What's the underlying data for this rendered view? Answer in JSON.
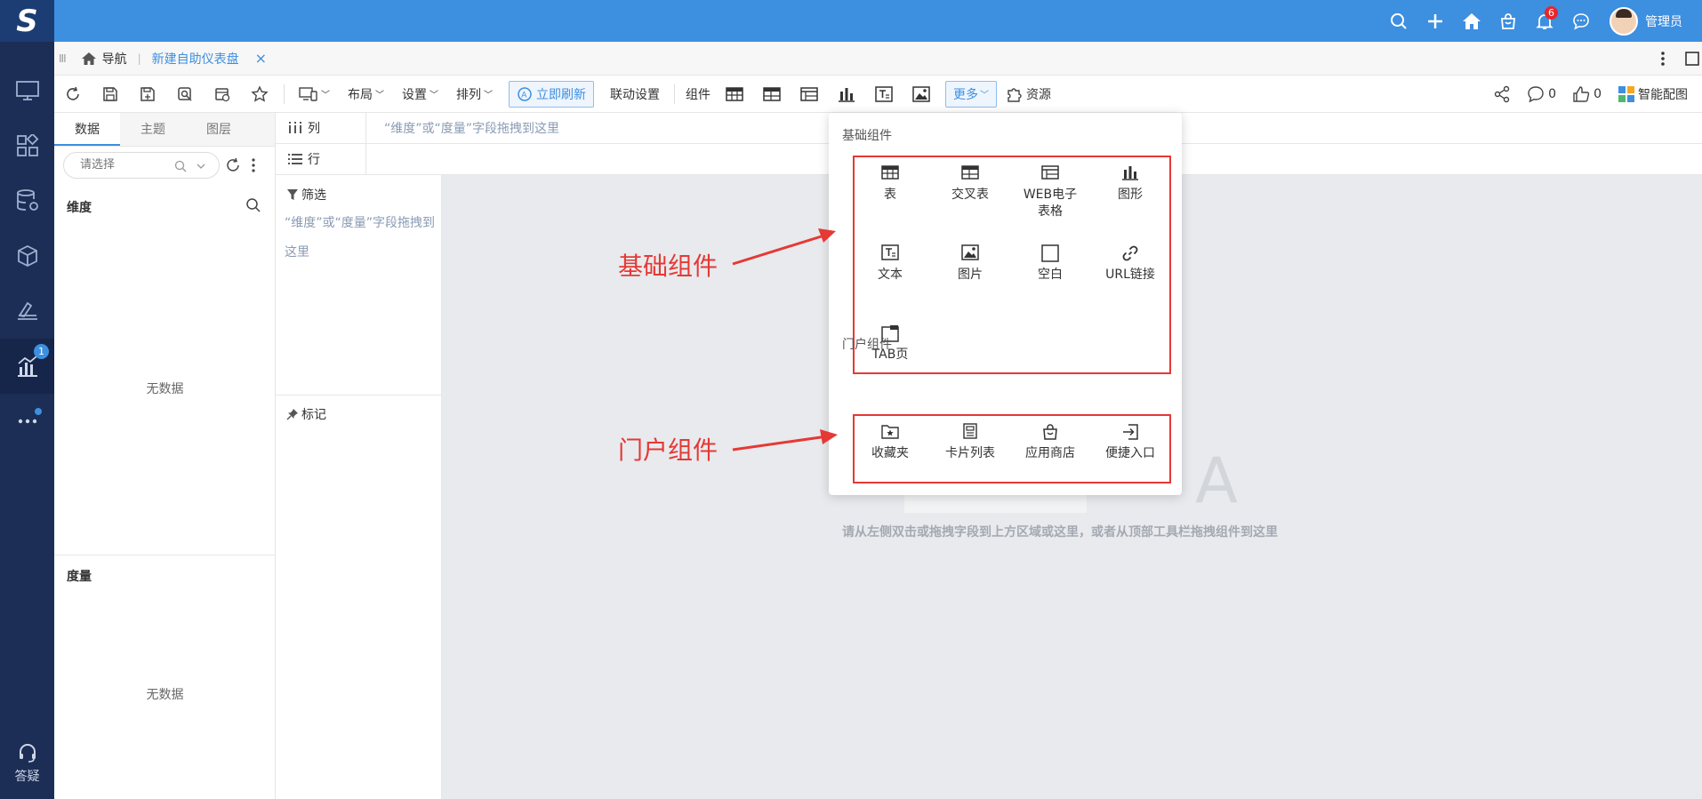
{
  "colors": {
    "topbar": "#3d8fe0",
    "sidebar": "#1c2e56",
    "accent": "#3d8fe0",
    "annotation": "#e53935"
  },
  "topbar": {
    "logo": "S",
    "icons": [
      "search-icon",
      "plus-icon",
      "home-icon",
      "shop-icon",
      "bell-icon",
      "message-icon"
    ],
    "notification_count": "6",
    "user_name": "管理员"
  },
  "sidebar": {
    "items": [
      "monitor-icon",
      "apps-icon",
      "database-gear-icon",
      "cube-icon",
      "design-icon",
      "chart-icon",
      "more-icon"
    ],
    "chart_badge": "1",
    "help_label": "答疑"
  },
  "tabbar": {
    "grip": "III",
    "nav_label": "导航",
    "active_tab": "新建自助仪表盘",
    "close": "×"
  },
  "toolbar": {
    "layout_label": "布局",
    "settings_label": "设置",
    "arrange_label": "排列",
    "refresh_label": "立即刷新",
    "linkage_label": "联动设置",
    "components_label": "组件",
    "more_label": "更多",
    "resources_label": "资源",
    "comment_count": "0",
    "like_count": "0",
    "smart_label": "智能配图"
  },
  "data_panel": {
    "tabs": [
      "数据",
      "主题",
      "图层"
    ],
    "select_placeholder": "请选择",
    "dimension_label": "维度",
    "measure_label": "度量",
    "no_data": "无数据"
  },
  "field_area": {
    "column_label": "列",
    "row_label": "行",
    "drop_hint": "“维度”或“度量”字段拖拽到这里"
  },
  "filter": {
    "title": "筛选",
    "hint": "“维度”或“度量”字段拖拽到这里",
    "mark_title": "标记"
  },
  "canvas": {
    "big_letter": "A",
    "hint": "请从左侧双击或拖拽字段到上方区域或这里，或者从顶部工具栏拖拽组件到这里"
  },
  "dropdown": {
    "basic_title": "基础组件",
    "portal_title": "门户组件",
    "basic_items": [
      "表",
      "交叉表",
      "WEB电子表格",
      "图形",
      "文本",
      "图片",
      "空白",
      "URL链接",
      "TAB页"
    ],
    "portal_items": [
      "收藏夹",
      "卡片列表",
      "应用商店",
      "便捷入口"
    ]
  },
  "annotations": {
    "basic": "基础组件",
    "portal": "门户组件"
  }
}
